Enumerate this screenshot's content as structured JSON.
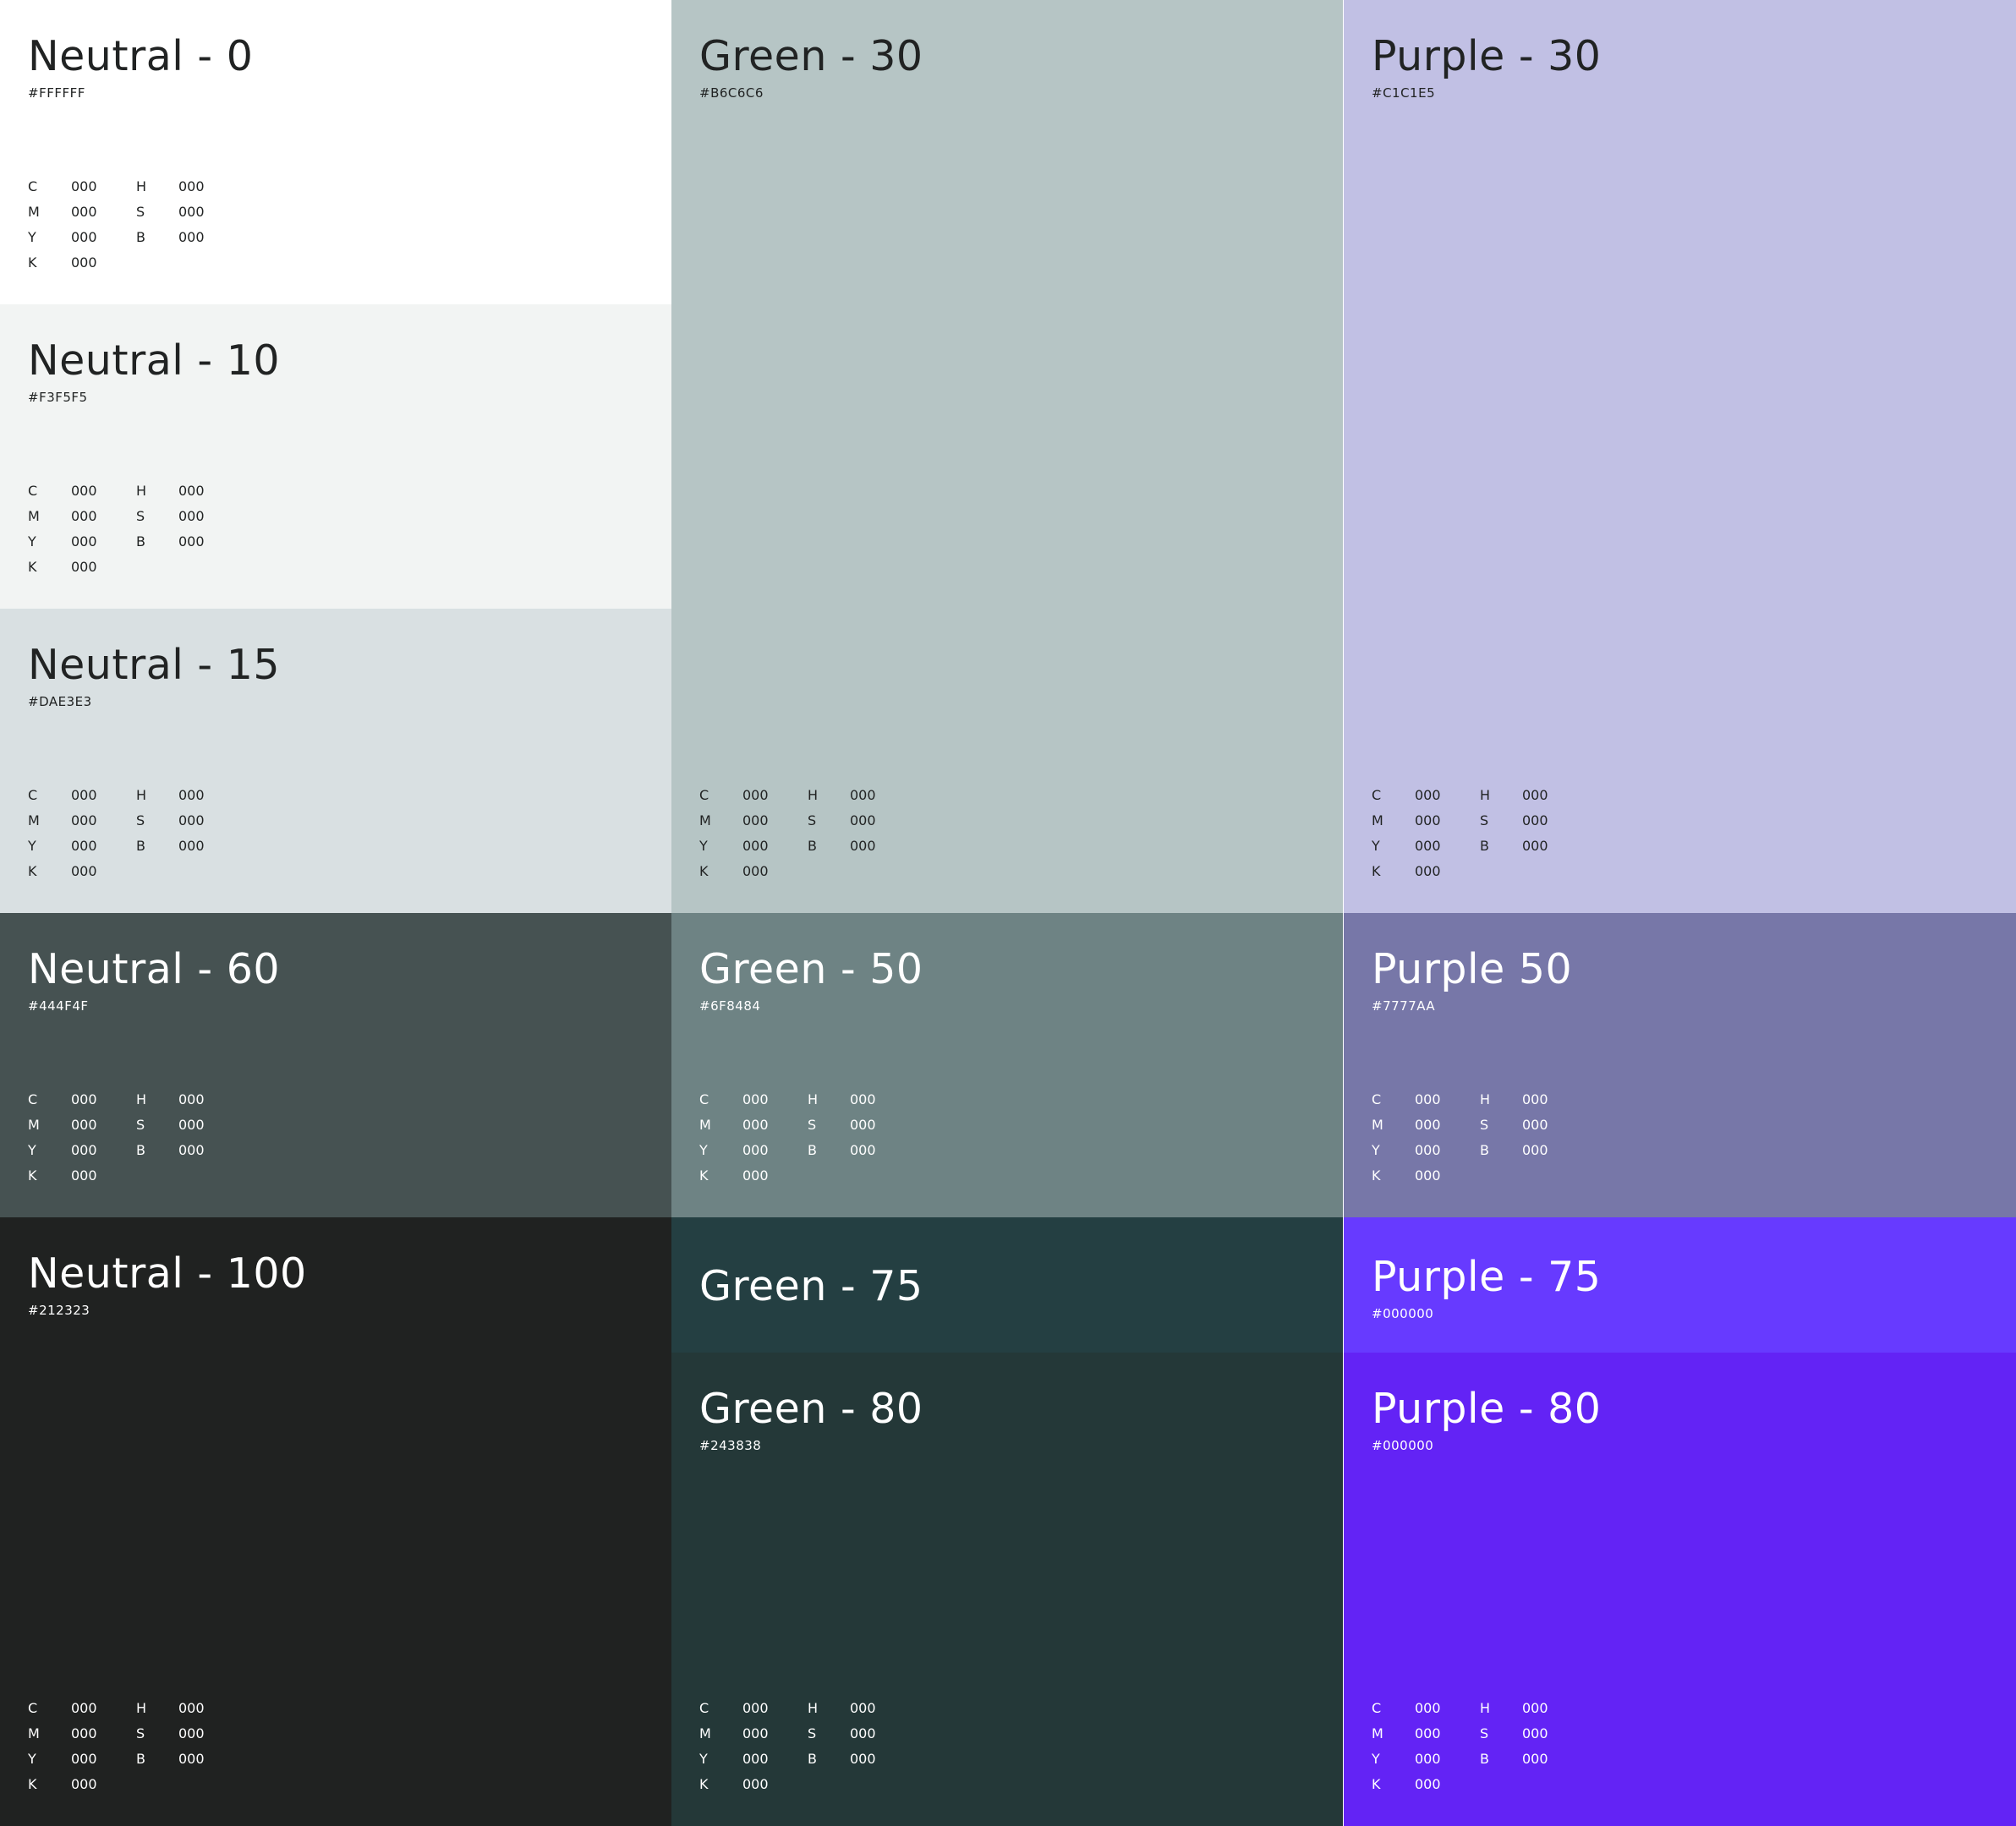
{
  "neutral": {
    "n0": {
      "title": "Neutral - 0",
      "hex": "#FFFFFF",
      "bg": "#FFFFFF",
      "text": "#212323"
    },
    "n10": {
      "title": "Neutral - 10",
      "hex": "#F3F5F5",
      "bg": "#F2F4F3",
      "text": "#212323"
    },
    "n15": {
      "title": "Neutral - 15",
      "hex": "#DAE3E3",
      "bg": "#D9E0E2",
      "text": "#212323"
    },
    "n60": {
      "title": "Neutral - 60",
      "hex": "#444F4F",
      "bg": "#465252",
      "text": "#FFFFFF"
    },
    "n100": {
      "title": "Neutral - 100",
      "hex": "#212323",
      "bg": "#202221",
      "text": "#FFFFFF"
    }
  },
  "green": {
    "g30": {
      "title": "Green - 30",
      "hex": "#B6C6C6",
      "bg": "#B6C5C5",
      "text": "#212323"
    },
    "g50": {
      "title": "Green - 50",
      "hex": "#6F8484",
      "bg": "#6E8384",
      "text": "#FFFFFF"
    },
    "g75": {
      "title": "Green - 75",
      "bg": "#243F42",
      "text": "#FFFFFF"
    },
    "g80": {
      "title": "Green - 80",
      "hex": "#243838",
      "bg": "#243838",
      "text": "#FFFFFF"
    }
  },
  "purple": {
    "p30": {
      "title": "Purple - 30",
      "hex": "#C1C1E5",
      "bg": "#C1C0E4",
      "text": "#212323"
    },
    "p50": {
      "title": "Purple 50",
      "hex": "#7777AA",
      "bg": "#7777A8",
      "text": "#FFFFFF"
    },
    "p75": {
      "title": "Purple - 75",
      "hex": "#000000",
      "bg": "#673AFF",
      "text": "#FFFFFF"
    },
    "p80": {
      "title": "Purple - 80",
      "hex": "#000000",
      "bg": "#6323F5",
      "text": "#FFFFFF"
    }
  },
  "values": {
    "c_label": "C",
    "m_label": "M",
    "y_label": "Y",
    "k_label": "K",
    "h_label": "H",
    "s_label": "S",
    "b_label": "B",
    "c": "000",
    "m": "000",
    "y": "000",
    "k": "000",
    "h": "000",
    "s": "000",
    "b": "000"
  }
}
